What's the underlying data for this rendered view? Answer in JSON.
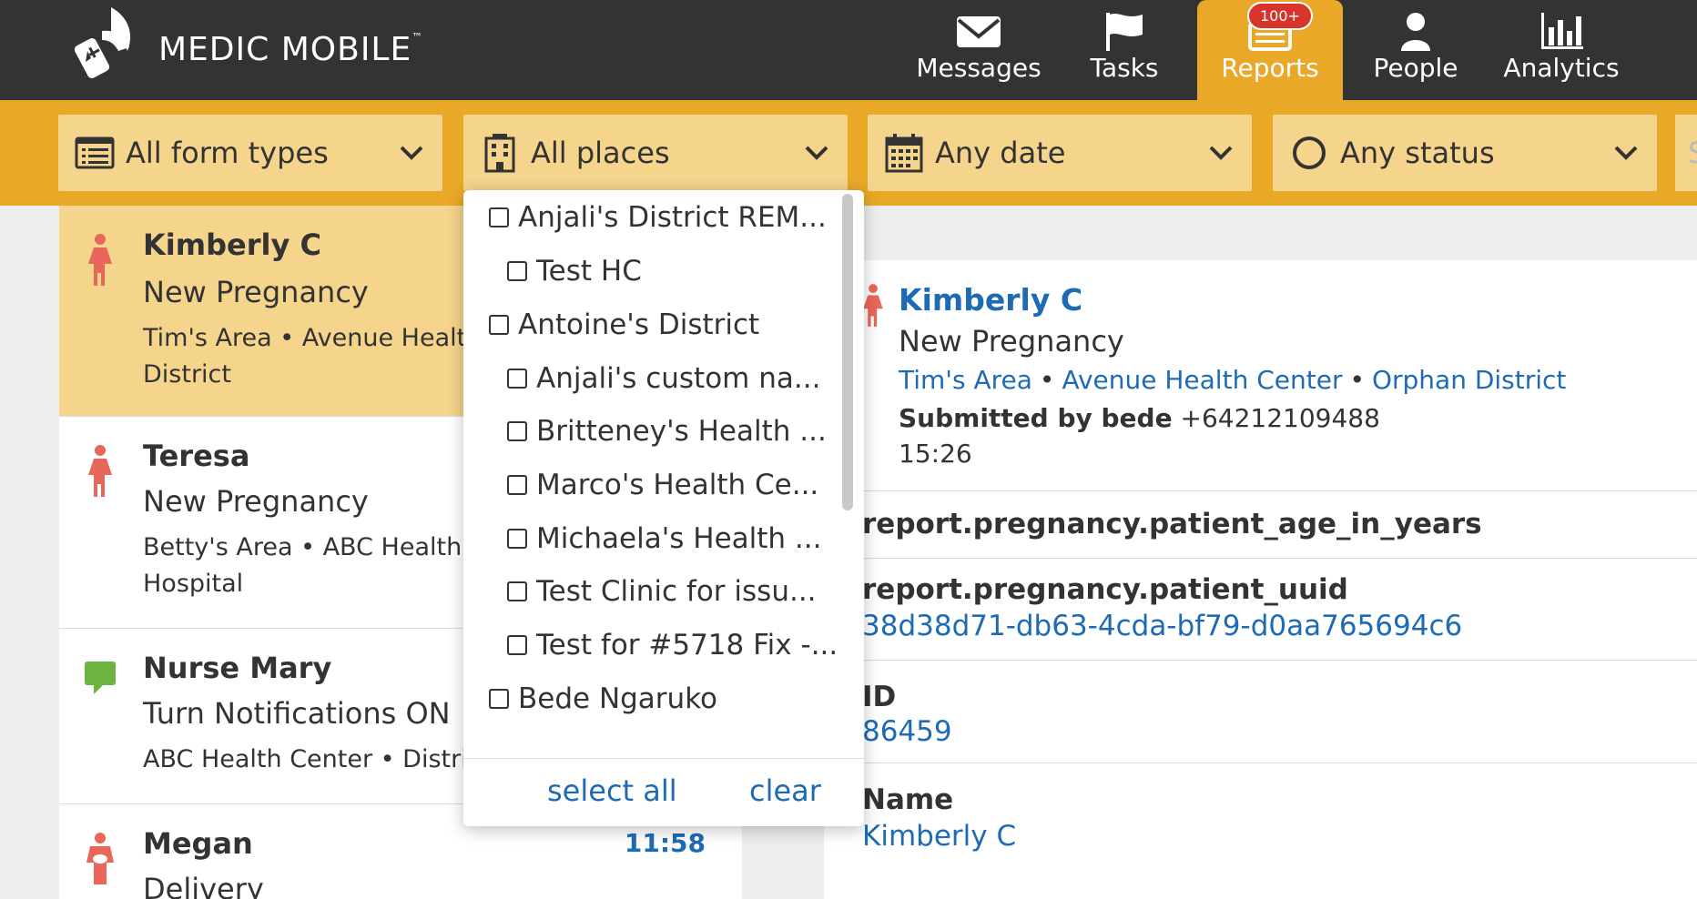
{
  "brand": {
    "name": "MEDIC MOBILE",
    "tm": "™"
  },
  "nav": {
    "messages": "Messages",
    "tasks": "Tasks",
    "reports": "Reports",
    "reports_badge": "100+",
    "people": "People",
    "analytics": "Analytics"
  },
  "filters": {
    "form_types": "All form types",
    "places": "All places",
    "date": "Any date",
    "status": "Any status",
    "search_stub": "S"
  },
  "reports": [
    {
      "name": "Kimberly C",
      "form": "New Pregnancy",
      "place_line1": "Tim's Area • Avenue Health",
      "place_line2": "District",
      "time": ""
    },
    {
      "name": "Teresa",
      "form": "New Pregnancy",
      "place_line1": "Betty's Area • ABC Health C",
      "place_line2": "Hospital",
      "time": ""
    },
    {
      "name": "Nurse Mary",
      "form": "Turn Notifications ON",
      "place_line1": "ABC Health Center • Distric",
      "place_line2": "",
      "time": ""
    },
    {
      "name": "Megan",
      "form": "Delivery",
      "place_line1": "",
      "place_line2": "",
      "time": "11:58"
    }
  ],
  "dropdown": {
    "items": [
      "Anjali's District REM...",
      "Test HC",
      "Antoine's District",
      "Anjali's custom na...",
      "Britteney's Health ...",
      "Marco's Health Ce...",
      "Michaela's Health ...",
      "Test Clinic for issu...",
      "Test for #5718 Fix -...",
      "Bede Ngaruko"
    ],
    "select_all": "select all",
    "clear": "clear"
  },
  "detail": {
    "name": "Kimberly C",
    "form": "New Pregnancy",
    "places": [
      "Tim's Area",
      "Avenue Health Center",
      "Orphan District"
    ],
    "separator": "•",
    "submitted_by_label": "Submitted by bede",
    "submitted_by_phone": "+64212109488",
    "time": "15:26",
    "fields": [
      {
        "label": "report.pregnancy.patient_age_in_years",
        "value": ""
      },
      {
        "label": "report.pregnancy.patient_uuid",
        "value": "38d38d71-db63-4cda-bf79-d0aa765694c6"
      },
      {
        "label": "ID",
        "value": "86459"
      },
      {
        "label": "Name",
        "value": "Kimberly C"
      }
    ]
  },
  "colors": {
    "header_bg": "#333333",
    "accent": "#e9a828",
    "filter_bg": "#f5d48c",
    "link": "#1d6bb5",
    "pregnancy_icon": "#e8675a",
    "message_icon": "#6db33f",
    "badge": "#d9342b"
  },
  "icons": {
    "logo": "medic-mobile-logo",
    "messages": "envelope-icon",
    "tasks": "flag-icon",
    "reports": "reports-icon",
    "people": "person-icon",
    "analytics": "bar-chart-icon",
    "form_types": "list-icon",
    "places": "building-icon",
    "date": "calendar-icon",
    "status": "circle-icon",
    "pregnancy": "pregnant-woman-icon",
    "message": "speech-bubble-icon",
    "delivery": "mother-baby-icon"
  }
}
